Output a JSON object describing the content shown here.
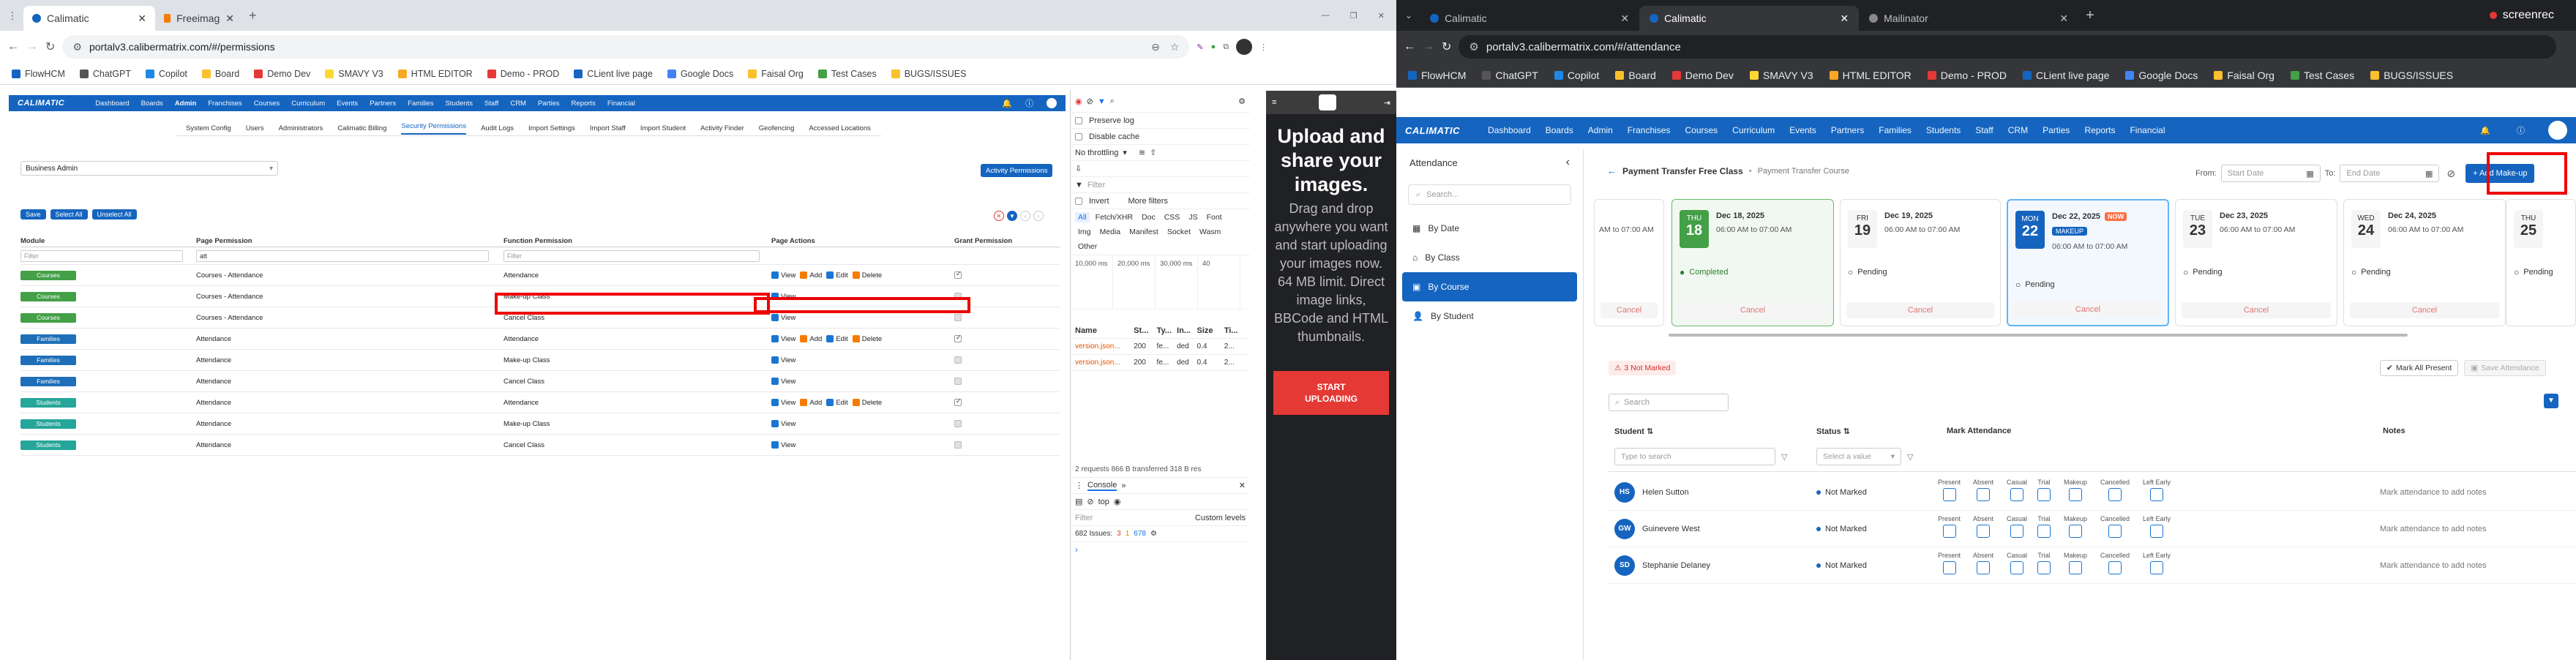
{
  "left_browser": {
    "tabs": [
      {
        "label": "Calimatic"
      },
      {
        "label": "Freeimag"
      }
    ],
    "url": "portalv3.calibermatrix.com/#/permissions",
    "bookmarks": [
      "FlowHCM",
      "ChatGPT",
      "Copilot",
      "Board",
      "Demo Dev",
      "SMAVY V3",
      "HTML EDITOR",
      "Demo - PROD",
      "CLient live page",
      "Google Docs",
      "Faisal Org",
      "Test Cases",
      "BUGS/ISSUES"
    ]
  },
  "left_app": {
    "logo": "CALIMATIC",
    "nav": [
      "Dashboard",
      "Boards",
      "Admin",
      "Franchises",
      "Courses",
      "Curriculum",
      "Events",
      "Partners",
      "Families",
      "Students",
      "Staff",
      "CRM",
      "Parties",
      "Reports",
      "Financial"
    ],
    "subnav": [
      "System Config",
      "Users",
      "Administrators",
      "Calimatic Billing",
      "Security Permissions",
      "Audit Logs",
      "Import Settings",
      "Import Staff",
      "Import Student",
      "Activity Finder",
      "Geofencing",
      "Accessed Locations"
    ],
    "subnav_active_index": 4,
    "role_select": "Business Admin",
    "activity_btn": "Activity Permissions",
    "buttons": [
      "Save",
      "Select All",
      "Unselect All"
    ],
    "headers": {
      "module": "Module",
      "page": "Page Permission",
      "func": "Function Permission",
      "actions": "Page Actions",
      "grant": "Grant Permission"
    },
    "filters": {
      "module": "Filter",
      "page": "att",
      "func": "Filter"
    },
    "action_labels": {
      "view": "View",
      "add": "Add",
      "edit": "Edit",
      "delete": "Delete"
    },
    "rows": [
      {
        "module": "Courses",
        "mcolor": "#43a047",
        "page": "Courses - Attendance",
        "func": "Attendance",
        "actions": [
          "view",
          "add",
          "edit",
          "delete"
        ],
        "grant": true
      },
      {
        "module": "Courses",
        "mcolor": "#43a047",
        "page": "Courses - Attendance",
        "func": "Make-up Class",
        "actions": [
          "view"
        ],
        "grant": false
      },
      {
        "module": "Courses",
        "mcolor": "#43a047",
        "page": "Courses - Attendance",
        "func": "Cancel Class",
        "actions": [
          "view"
        ],
        "grant": false
      },
      {
        "module": "Families",
        "mcolor": "#1e6fb8",
        "page": "Attendance",
        "func": "Attendance",
        "actions": [
          "view",
          "add",
          "edit",
          "delete"
        ],
        "grant": true
      },
      {
        "module": "Families",
        "mcolor": "#1e6fb8",
        "page": "Attendance",
        "func": "Make-up Class",
        "actions": [
          "view"
        ],
        "grant": false
      },
      {
        "module": "Families",
        "mcolor": "#1e6fb8",
        "page": "Attendance",
        "func": "Cancel Class",
        "actions": [
          "view"
        ],
        "grant": false
      },
      {
        "module": "Students",
        "mcolor": "#26a69a",
        "page": "Attendance",
        "func": "Attendance",
        "actions": [
          "view",
          "add",
          "edit",
          "delete"
        ],
        "grant": true
      },
      {
        "module": "Students",
        "mcolor": "#26a69a",
        "page": "Attendance",
        "func": "Make-up Class",
        "actions": [
          "view"
        ],
        "grant": false
      },
      {
        "module": "Students",
        "mcolor": "#26a69a",
        "page": "Attendance",
        "func": "Cancel Class",
        "actions": [
          "view"
        ],
        "grant": false
      }
    ]
  },
  "devtools": {
    "preserve_log": "Preserve log",
    "disable_cache": "Disable cache",
    "throttle": "No throttling",
    "filter": "Filter",
    "invert": "Invert",
    "more_filters": "More filters",
    "types": [
      "All",
      "Fetch/XHR",
      "Doc",
      "CSS",
      "JS",
      "Font",
      "Img",
      "Media",
      "Manifest",
      "Socket",
      "Wasm",
      "Other"
    ],
    "timeline": [
      "10,000 ms",
      "20,000 ms",
      "30,000 ms",
      "40"
    ],
    "cols": [
      "Name",
      "St...",
      "Ty...",
      "In...",
      "Size",
      "Ti..."
    ],
    "requests": [
      {
        "name": "version.json...",
        "st": "200",
        "ty": "fe...",
        "in": "ded",
        "size": "0.4",
        "ti": "2..."
      },
      {
        "name": "version.json...",
        "st": "200",
        "ty": "fe...",
        "in": "ded",
        "size": "0.4",
        "ti": "2..."
      }
    ],
    "summary": "2 requests   866 B transferred   318 B res",
    "console_tab": "Console",
    "top": "top",
    "filter2": "Filter",
    "levels": "Custom levels",
    "issues": "682 Issues:",
    "issue_counts": [
      "3",
      "1",
      "678"
    ]
  },
  "ad": {
    "headline": "Upload and share your images.",
    "body": "Drag and drop anywhere you want and start uploading your images now. 64 MB limit. Direct image links, BBCode and HTML thumbnails.",
    "button": "START UPLOADING"
  },
  "right_browser": {
    "tabs": [
      {
        "label": "Calimatic"
      },
      {
        "label": "Calimatic"
      },
      {
        "label": "Mailinator"
      }
    ],
    "url": "portalv3.calibermatrix.com/#/attendance",
    "recorder": "screenrec",
    "bookmarks": [
      "FlowHCM",
      "ChatGPT",
      "Copilot",
      "Board",
      "Demo Dev",
      "SMAVY V3",
      "HTML EDITOR",
      "Demo - PROD",
      "CLient live page",
      "Google Docs",
      "Faisal Org",
      "Test Cases",
      "BUGS/ISSUES"
    ]
  },
  "right_app": {
    "logo": "CALIMATIC",
    "nav": [
      "Dashboard",
      "Boards",
      "Admin",
      "Franchises",
      "Courses",
      "Curriculum",
      "Events",
      "Partners",
      "Families",
      "Students",
      "Staff",
      "CRM",
      "Parties",
      "Reports",
      "Financial"
    ],
    "sidebar_title": "Attendance",
    "search": "Search...",
    "side_items": [
      "By Date",
      "By Class",
      "By Course",
      "By Student"
    ],
    "side_selected": 2,
    "breadcrumb_main": "Payment Transfer Free Class",
    "breadcrumb_sub": "Payment Transfer Course",
    "from_label": "From:",
    "start_ph": "Start Date",
    "to_label": "To:",
    "end_ph": "End Date",
    "add_makeup": "+ Add Make-up",
    "cards": [
      {
        "dow": "",
        "day": "",
        "date": "",
        "time": "AM to 07:00 AM",
        "status": "",
        "cancel": "Cancel",
        "partial": true
      },
      {
        "dow": "THU",
        "day": "18",
        "date": "Dec 18, 2025",
        "time": "06:00 AM to 07:00 AM",
        "status": "Completed",
        "cancel": "Cancel",
        "style": "completed"
      },
      {
        "dow": "FRI",
        "day": "19",
        "date": "Dec 19, 2025",
        "time": "06:00 AM to 07:00 AM",
        "status": "Pending",
        "cancel": "Cancel"
      },
      {
        "dow": "MON",
        "day": "22",
        "date": "Dec 22, 2025",
        "time": "06:00 AM to 07:00 AM",
        "status": "Pending",
        "cancel": "Cancel",
        "style": "now",
        "badge": "NOW",
        "makeup": "MAKEUP"
      },
      {
        "dow": "TUE",
        "day": "23",
        "date": "Dec 23, 2025",
        "time": "06:00 AM to 07:00 AM",
        "status": "Pending",
        "cancel": "Cancel"
      },
      {
        "dow": "WED",
        "day": "24",
        "date": "Dec 24, 2025",
        "time": "06:00 AM to 07:00 AM",
        "status": "Pending",
        "cancel": "Cancel"
      },
      {
        "dow": "THU",
        "day": "25",
        "date": "",
        "time": "",
        "status": "Pending",
        "cancel": "",
        "partial": true
      }
    ],
    "not_marked_badge": "3  Not Marked",
    "mark_all": "Mark All Present",
    "save_att": "Save Attendance",
    "search2": "Search",
    "col_student": "Student",
    "col_status": "Status",
    "col_mark": "Mark Attendance",
    "col_notes": "Notes",
    "type_search": "Type to search",
    "select_value": "Select a value",
    "mark_labels": [
      "Present",
      "Absent",
      "Casual",
      "Trial",
      "Makeup",
      "Cancelled",
      "Left Early"
    ],
    "students": [
      {
        "initials": "HS",
        "name": "Helen Sutton",
        "status": "Not Marked",
        "notes": "Mark attendance to add notes"
      },
      {
        "initials": "GW",
        "name": "Guinevere West",
        "status": "Not Marked",
        "notes": "Mark attendance to add notes"
      },
      {
        "initials": "SD",
        "name": "Stephanie Delaney",
        "status": "Not Marked",
        "notes": "Mark attendance to add notes"
      }
    ]
  }
}
